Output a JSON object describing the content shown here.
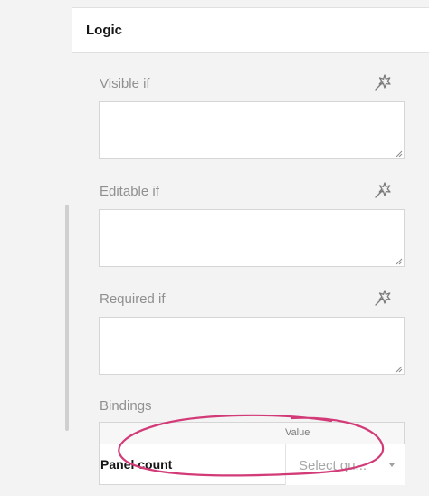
{
  "section": {
    "title": "Logic"
  },
  "fields": [
    {
      "label": "Visible if"
    },
    {
      "label": "Editable if"
    },
    {
      "label": "Required if"
    }
  ],
  "bindings": {
    "label": "Bindings",
    "column_header": "Value",
    "rows": [
      {
        "name": "Panel count",
        "select_placeholder": "Select qu..."
      }
    ]
  },
  "icons": {
    "expression_builder": "magic-wand-icon",
    "dropdown": "chevron-down-icon"
  },
  "colors": {
    "annotation_stroke": "#d23a78"
  }
}
